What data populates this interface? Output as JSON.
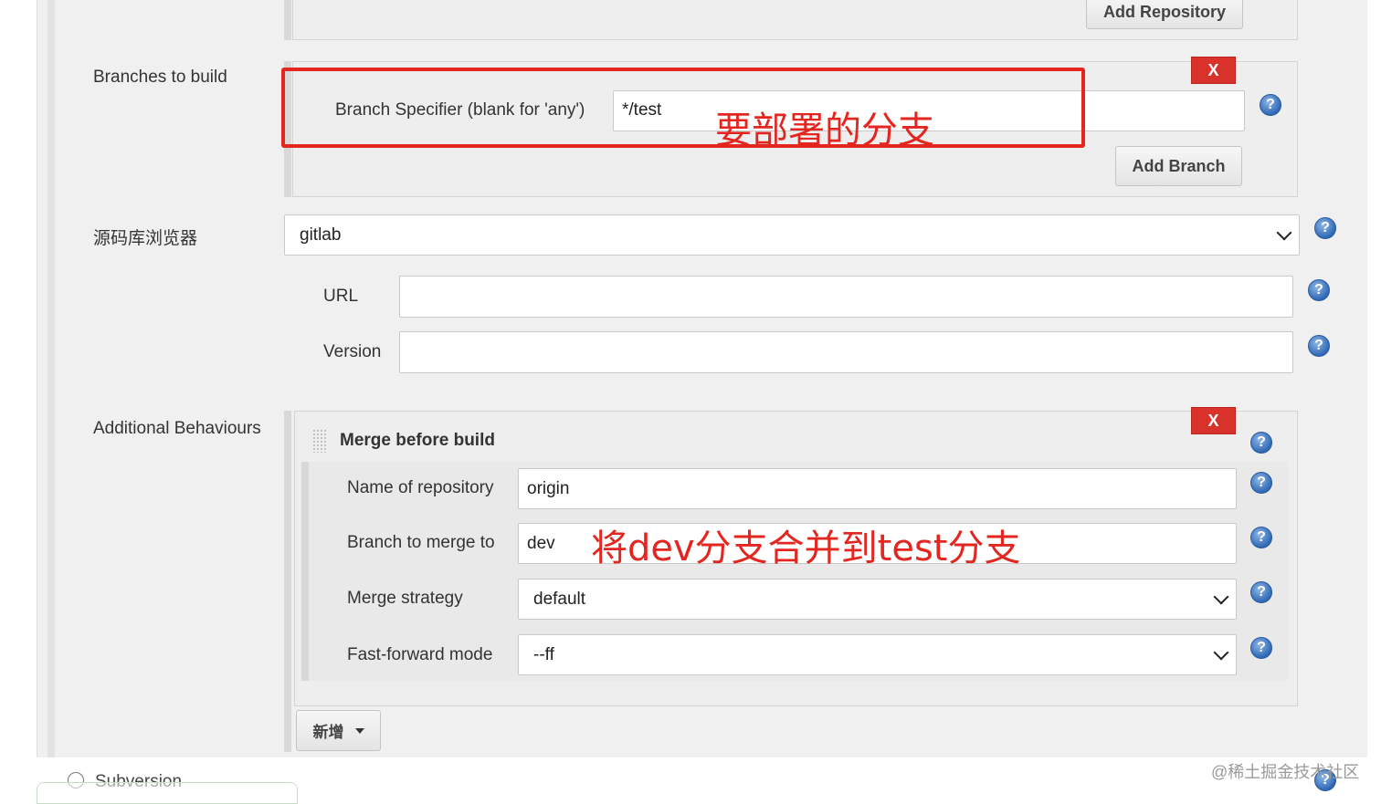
{
  "repositories": {
    "add_repository_label": "Add Repository"
  },
  "branches": {
    "section_label": "Branches to build",
    "delete_label": "X",
    "specifier_label": "Branch Specifier (blank for 'any')",
    "specifier_value": "*/test",
    "add_branch_label": "Add Branch",
    "annotation": "要部署的分支"
  },
  "browser": {
    "section_label": "源码库浏览器",
    "selected": "gitlab",
    "url_label": "URL",
    "url_value": "",
    "version_label": "Version",
    "version_value": ""
  },
  "behaviours": {
    "section_label": "Additional Behaviours",
    "delete_label": "X",
    "merge": {
      "title": "Merge before build",
      "repo_label": "Name of repository",
      "repo_value": "origin",
      "branch_label": "Branch to merge to",
      "branch_value": "dev",
      "annotation": "将dev分支合并到test分支",
      "strategy_label": "Merge strategy",
      "strategy_value": "default",
      "ff_label": "Fast-forward mode",
      "ff_value": "--ff"
    },
    "add_label": "新增"
  },
  "scm": {
    "subversion_label": "Subversion"
  },
  "help_glyph": "?",
  "watermark": "@稀土掘金技术社区",
  "colors": {
    "accent_red": "#e3261f",
    "delete_red": "#d9322a",
    "help_blue": "#2f69b5"
  }
}
